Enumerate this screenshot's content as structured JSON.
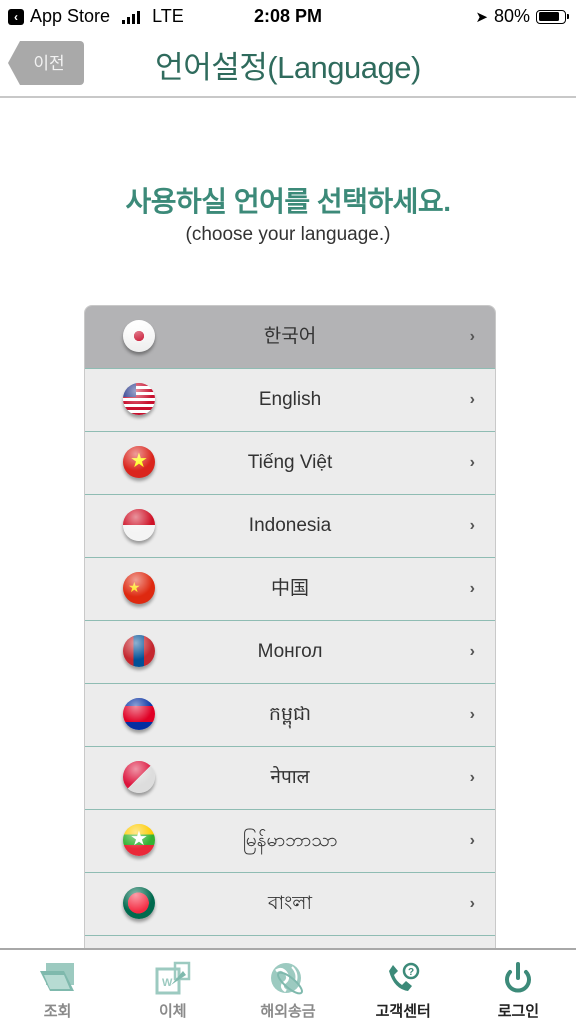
{
  "status_bar": {
    "back_app": "App Store",
    "network": "LTE",
    "time": "2:08 PM",
    "battery": "80%",
    "battery_level": 0.8
  },
  "header": {
    "back_label": "이전",
    "title": "언어설정(Language)"
  },
  "prompt": {
    "title": "사용하실 언어를 선택하세요.",
    "subtitle": "(choose your language.)"
  },
  "languages": [
    {
      "label": "한국어",
      "flag": "korea",
      "selected": true
    },
    {
      "label": "English",
      "flag": "liberia",
      "selected": false
    },
    {
      "label": "Tiếng Việt",
      "flag": "vietnam",
      "selected": false
    },
    {
      "label": "Indonesia",
      "flag": "indonesia",
      "selected": false
    },
    {
      "label": "中国",
      "flag": "china",
      "selected": false
    },
    {
      "label": "Монгол",
      "flag": "mongolia",
      "selected": false
    },
    {
      "label": "កម្ពុជា",
      "flag": "cambodia",
      "selected": false
    },
    {
      "label": "नेपाल",
      "flag": "nepal",
      "selected": false
    },
    {
      "label": "မြန်မာဘာသာ",
      "flag": "myanmar",
      "selected": false
    },
    {
      "label": "বাংলা",
      "flag": "bangladesh",
      "selected": false
    },
    {
      "label": "",
      "flag": "",
      "selected": false
    }
  ],
  "chevron": "›",
  "tabbar": {
    "items": [
      {
        "label": "조회",
        "icon": "folder-icon",
        "active": false
      },
      {
        "label": "이체",
        "icon": "transfer-won-icon",
        "active": false
      },
      {
        "label": "해외송금",
        "icon": "globe-icon",
        "active": false
      },
      {
        "label": "고객센터",
        "icon": "phone-help-icon",
        "active": true
      },
      {
        "label": "로그인",
        "icon": "power-icon",
        "active": true
      }
    ]
  },
  "colors": {
    "title": "#2f6b5d",
    "prompt": "#3c8a79",
    "icon_active": "#3c8a79",
    "icon_inactive": "#9ccac0",
    "divider": "#8fbcb3",
    "selected_row": "#b3b3b5"
  }
}
